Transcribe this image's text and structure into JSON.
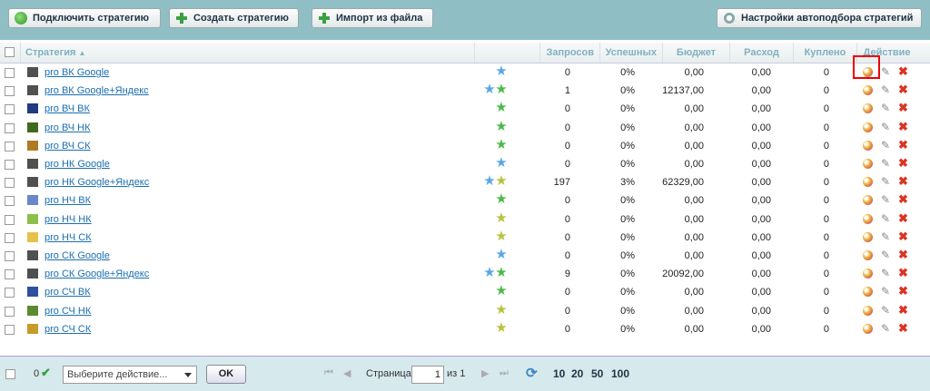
{
  "toolbar": {
    "connect_label": "Подключить стратегию",
    "create_label": "Создать стратегию",
    "import_label": "Импорт из файла",
    "autoselect_label": "Настройки автоподбора стратегий"
  },
  "table": {
    "columns": {
      "strategy": "Стратегия",
      "requests": "Запросов",
      "successful": "Успешных",
      "budget": "Бюджет",
      "spend": "Расход",
      "bought": "Куплено",
      "action": "Действие"
    },
    "rows": [
      {
        "name": "pro ВК Google",
        "color": "#505050",
        "stars": [
          "blue"
        ],
        "requests": "0",
        "successful": "0%",
        "budget": "0,00",
        "spend": "0,00",
        "bought": "0"
      },
      {
        "name": "pro ВК Google+Яндекс",
        "color": "#505050",
        "stars": [
          "blue",
          "green"
        ],
        "requests": "1",
        "successful": "0%",
        "budget": "12137,00",
        "spend": "0,00",
        "bought": "0"
      },
      {
        "name": "pro ВЧ ВК",
        "color": "#1f3b82",
        "stars": [
          "green"
        ],
        "requests": "0",
        "successful": "0%",
        "budget": "0,00",
        "spend": "0,00",
        "bought": "0"
      },
      {
        "name": "pro ВЧ НК",
        "color": "#3f6a1e",
        "stars": [
          "green"
        ],
        "requests": "0",
        "successful": "0%",
        "budget": "0,00",
        "spend": "0,00",
        "bought": "0"
      },
      {
        "name": "pro ВЧ СК",
        "color": "#b07a22",
        "stars": [
          "green"
        ],
        "requests": "0",
        "successful": "0%",
        "budget": "0,00",
        "spend": "0,00",
        "bought": "0"
      },
      {
        "name": "pro НК Google",
        "color": "#505050",
        "stars": [
          "blue"
        ],
        "requests": "0",
        "successful": "0%",
        "budget": "0,00",
        "spend": "0,00",
        "bought": "0"
      },
      {
        "name": "pro НК Google+Яндекс",
        "color": "#505050",
        "stars": [
          "blue",
          "yellow"
        ],
        "requests": "197",
        "successful": "3%",
        "budget": "62329,00",
        "spend": "0,00",
        "bought": "0"
      },
      {
        "name": "pro НЧ ВК",
        "color": "#6a86c8",
        "stars": [
          "green"
        ],
        "requests": "0",
        "successful": "0%",
        "budget": "0,00",
        "spend": "0,00",
        "bought": "0"
      },
      {
        "name": "pro НЧ НК",
        "color": "#8cc04a",
        "stars": [
          "yellow"
        ],
        "requests": "0",
        "successful": "0%",
        "budget": "0,00",
        "spend": "0,00",
        "bought": "0"
      },
      {
        "name": "pro НЧ СК",
        "color": "#e6c24a",
        "stars": [
          "yellow"
        ],
        "requests": "0",
        "successful": "0%",
        "budget": "0,00",
        "spend": "0,00",
        "bought": "0"
      },
      {
        "name": "pro СК Google",
        "color": "#505050",
        "stars": [
          "blue"
        ],
        "requests": "0",
        "successful": "0%",
        "budget": "0,00",
        "spend": "0,00",
        "bought": "0"
      },
      {
        "name": "pro СК Google+Яндекс",
        "color": "#505050",
        "stars": [
          "blue",
          "green"
        ],
        "requests": "9",
        "successful": "0%",
        "budget": "20092,00",
        "spend": "0,00",
        "bought": "0"
      },
      {
        "name": "pro СЧ ВК",
        "color": "#2f4fa0",
        "stars": [
          "green"
        ],
        "requests": "0",
        "successful": "0%",
        "budget": "0,00",
        "spend": "0,00",
        "bought": "0"
      },
      {
        "name": "pro СЧ НК",
        "color": "#5a8a2e",
        "stars": [
          "yellow"
        ],
        "requests": "0",
        "successful": "0%",
        "budget": "0,00",
        "spend": "0,00",
        "bought": "0"
      },
      {
        "name": "pro СЧ СК",
        "color": "#c79a2a",
        "stars": [
          "yellow"
        ],
        "requests": "0",
        "successful": "0%",
        "budget": "0,00",
        "spend": "0,00",
        "bought": "0"
      }
    ]
  },
  "footer": {
    "selected_count": "0",
    "action_placeholder": "Выберите действие...",
    "ok_label": "OK",
    "page_label": "Страница",
    "page_value": "1",
    "of_label": "из 1",
    "page_sizes": [
      "10",
      "20",
      "50",
      "100"
    ]
  },
  "colors": {
    "toolbar_bg": "#8fbfc5",
    "header_text": "#7fb1c0",
    "link": "#1a6fb0",
    "highlight": "#e00000"
  }
}
